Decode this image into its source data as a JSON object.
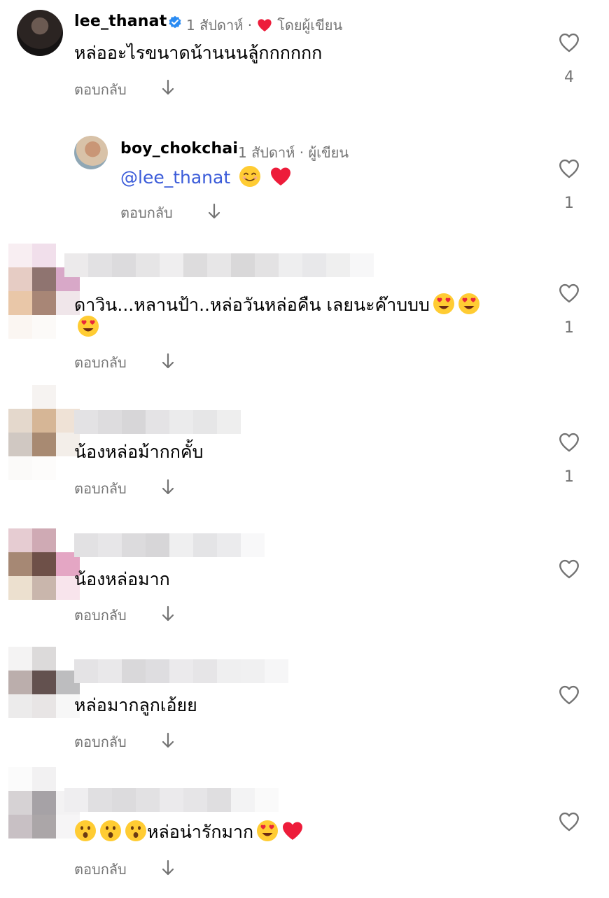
{
  "colors": {
    "mention": "#3a5bd9",
    "meta": "#737373",
    "heart": "#ed1c3a",
    "verified": "#2a8bf2"
  },
  "comments": [
    {
      "username": "lee_thanat",
      "verified": true,
      "time": "1 สัปดาห์ ·",
      "liked_by_author": "โดยผู้เขียน",
      "text": "หล่ออะไรขนาดน้านนนลู้กกกกกก",
      "reply": "ตอบกลับ",
      "likes": "4",
      "avatar": "profile-photo"
    },
    {
      "username": "boy_chokchai",
      "time": "1 สัปดาห์ · ผู้เขียน",
      "mention": "@lee_thanat",
      "reply": "ตอบกลับ",
      "likes": "1",
      "avatar": "profile-photo"
    },
    {
      "username": "",
      "text": "ดาวิน...หลานป้า..หล่อวันหล่อคืน เลยนะค๊าบบบ",
      "reply": "ตอบกลับ",
      "likes": "1",
      "avatar": "pixelated"
    },
    {
      "username": "",
      "text": "น้องหล่อม้ากกคั้บ",
      "reply": "ตอบกลับ",
      "likes": "1",
      "avatar": "pixelated"
    },
    {
      "username": "",
      "text": "น้องหล่อมาก",
      "reply": "ตอบกลับ",
      "likes": "",
      "avatar": "pixelated"
    },
    {
      "username": "",
      "text": "หล่อมากลูกเอ้ยย",
      "reply": "ตอบกลับ",
      "likes": "",
      "avatar": "pixelated"
    },
    {
      "username": "",
      "text": "หล่อน่ารักมาก",
      "reply": "ตอบกลับ",
      "likes": "",
      "avatar": "pixelated"
    }
  ],
  "icons": {
    "verified": "verified-badge-icon",
    "heart_filled": "heart-filled-icon",
    "heart_outline": "heart-outline-icon",
    "arrow": "arrow-down-icon",
    "smile": "smiling-face-emoji",
    "heart_eyes": "heart-eyes-emoji",
    "surprised": "surprised-face-emoji",
    "red_heart": "red-heart-emoji"
  }
}
